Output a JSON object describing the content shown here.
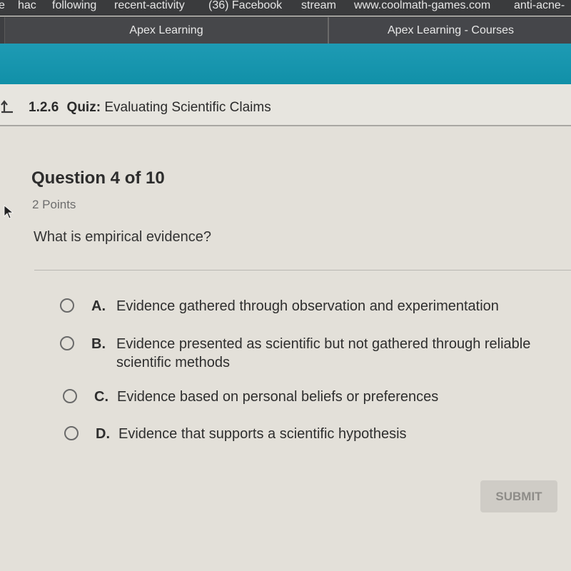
{
  "browser": {
    "bookmarks": [
      "e",
      "hac",
      "following",
      "recent-activity",
      "(36) Facebook",
      "stream",
      "www.coolmath-games.com",
      "anti-acne-"
    ],
    "tabs": [
      {
        "label": "Apex Learning",
        "active": false
      },
      {
        "label": "Apex Learning - Courses",
        "active": true
      }
    ]
  },
  "quiz": {
    "number": "1.2.6",
    "kind": "Quiz:",
    "title": "Evaluating Scientific Claims"
  },
  "question": {
    "heading": "Question 4 of 10",
    "points": "2 Points",
    "text": "What is empirical evidence?",
    "options": [
      {
        "letter": "A.",
        "text": "Evidence gathered through observation and experimentation",
        "selected": false
      },
      {
        "letter": "B.",
        "text_line1": "Evidence presented as scientific but not gathered through reliable",
        "text_line2": "scientific methods",
        "selected": false
      },
      {
        "letter": "C.",
        "text": "Evidence based on personal beliefs or preferences",
        "selected": false
      },
      {
        "letter": "D.",
        "text": "Evidence that supports a scientific hypothesis",
        "selected": false
      }
    ]
  },
  "actions": {
    "submit_label": "SUBMIT",
    "submit_enabled": false
  },
  "colors": {
    "header_teal": "#1e9bb4",
    "page_background": "#e3e0d9",
    "browser_chrome": "#3e3f42"
  }
}
